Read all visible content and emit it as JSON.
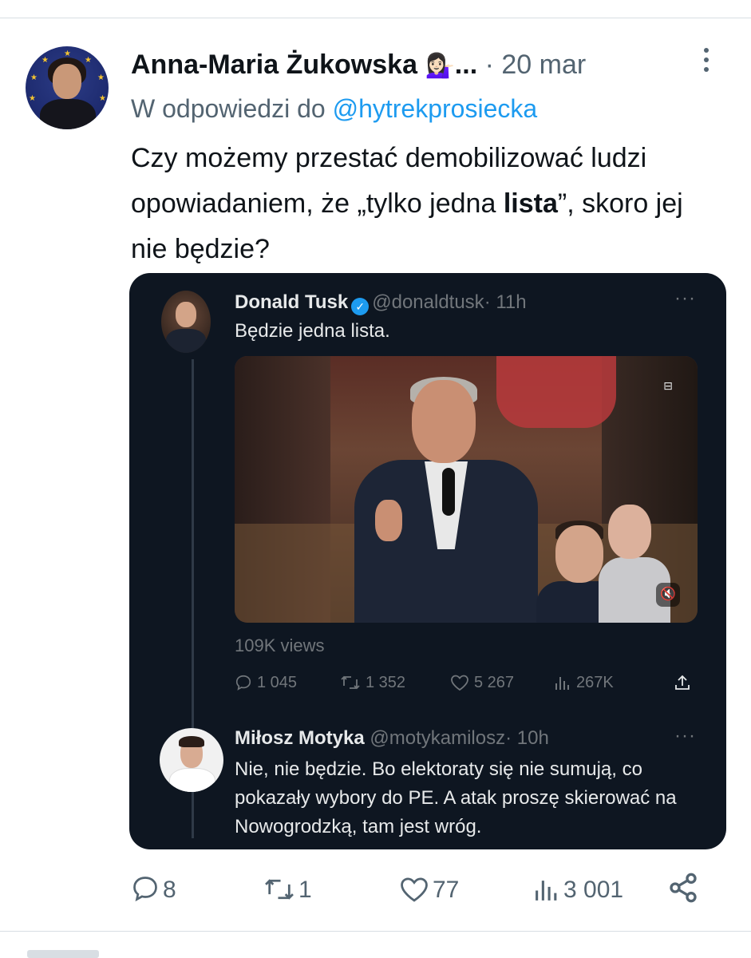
{
  "colors": {
    "link": "#1d9bf0",
    "muted": "#536471",
    "text": "#0f1419",
    "embed_bg": "#0e1621",
    "embed_text": "#e7e9ea",
    "embed_muted": "#71767b",
    "verified": "#1d9bf0"
  },
  "tweet": {
    "author_name": "Anna-Maria Żukowska",
    "author_emoji": "💁🏻‍♀️",
    "name_ellipsis": "...",
    "separator": " · ",
    "date": "20 mar",
    "reply_prefix": "W odpowiedzi do ",
    "reply_handle": "@hytrekprosiecka",
    "text_part1": "Czy możemy przestać demobilizować ludzi opowiadaniem, że „tylko jedna ",
    "text_bold": "lista",
    "text_part2": "”, skoro jej nie będzie?",
    "stats": {
      "replies": "8",
      "reposts": "1",
      "likes": "77",
      "views": "3 001"
    }
  },
  "embed": {
    "post1": {
      "name": "Donald Tusk",
      "handle": "@donaldtusk",
      "time": "· 11h",
      "dots": "···",
      "text": "Będzie jedna lista.",
      "views_text": "109K views",
      "replies": "1 045",
      "reposts": "1 352",
      "likes": "5 267",
      "views": "267K"
    },
    "post2": {
      "name": "Miłosz Motyka",
      "handle": "@motykamilosz",
      "time": "· 10h",
      "dots": "···",
      "text": "Nie, nie będzie. Bo elektoraty się nie sumują, co pokazały wybory do PE. A atak proszę skierować na Nowogrodzką, tam jest wróg."
    }
  }
}
